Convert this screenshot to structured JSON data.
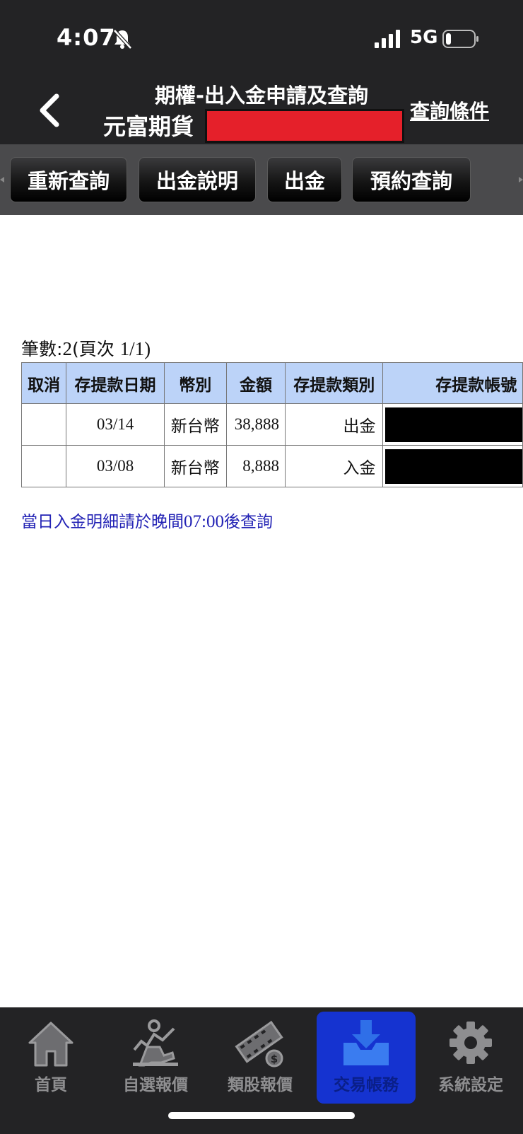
{
  "status_bar": {
    "time": "4:07",
    "network": "5G"
  },
  "header": {
    "title": "期權-出入金申請及查詢",
    "broker": "元富期貨",
    "query_conditions": "查詢條件"
  },
  "toolbar": {
    "buttons": [
      {
        "label": "重新查詢"
      },
      {
        "label": "出金說明"
      },
      {
        "label": "出金"
      },
      {
        "label": "預約查詢"
      }
    ]
  },
  "records": {
    "count_label": "筆數:",
    "count_value": "2",
    "page_label": "(頁次 ",
    "page_value": "1/1)"
  },
  "table": {
    "headers": {
      "cancel": "取消",
      "date": "存提款日期",
      "currency": "幣別",
      "amount": "金額",
      "type": "存提款類別",
      "account": "存提款帳號"
    },
    "rows": [
      {
        "cancel": "",
        "date": "03/14",
        "currency": "新台幣",
        "amount": "38,888",
        "type": "出金"
      },
      {
        "cancel": "",
        "date": "03/08",
        "currency": "新台幣",
        "amount": "8,888",
        "type": "入金"
      }
    ]
  },
  "notice": {
    "prefix": "當日入金明細請於晚間",
    "time": "07:00",
    "suffix": "後查詢"
  },
  "tab_bar": {
    "tabs": [
      {
        "label": "首頁",
        "icon": "home-icon",
        "active": false
      },
      {
        "label": "自選報價",
        "icon": "stock-reader-icon",
        "active": false
      },
      {
        "label": "類股報價",
        "icon": "film-coin-icon",
        "active": false
      },
      {
        "label": "交易帳務",
        "icon": "inbox-download-icon",
        "active": true
      },
      {
        "label": "系統設定",
        "icon": "gear-icon",
        "active": false
      }
    ]
  },
  "colors": {
    "header_bg": "#232325",
    "toolbar_bg": "#4a4a4c",
    "table_header_bg": "#bcd3f8",
    "notice_text": "#2323b5",
    "redaction_red": "#e5202a",
    "active_tab_bg": "#1533d0"
  }
}
